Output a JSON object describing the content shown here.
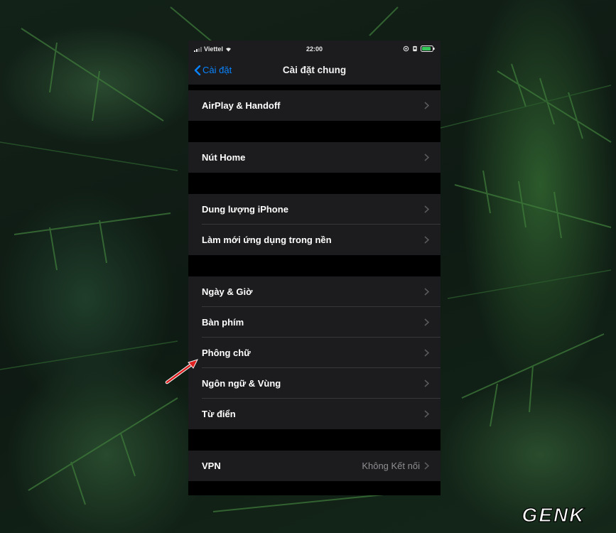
{
  "status_bar": {
    "carrier": "Viettel",
    "time": "22:00"
  },
  "nav": {
    "back_label": "Cài đặt",
    "title": "Cài đặt chung"
  },
  "groups": [
    {
      "items": [
        {
          "label": "AirPlay & Handoff"
        }
      ]
    },
    {
      "items": [
        {
          "label": "Nút Home"
        }
      ]
    },
    {
      "items": [
        {
          "label": "Dung lượng iPhone"
        },
        {
          "label": "Làm mới ứng dụng trong nền"
        }
      ]
    },
    {
      "items": [
        {
          "label": "Ngày & Giờ"
        },
        {
          "label": "Bàn phím"
        },
        {
          "label": "Phông chữ"
        },
        {
          "label": "Ngôn ngữ & Vùng"
        },
        {
          "label": "Từ điển"
        }
      ]
    },
    {
      "items": [
        {
          "label": "VPN",
          "value": "Không Kết nối"
        }
      ]
    }
  ],
  "watermark": "GENK",
  "colors": {
    "accent": "#0a84ff",
    "arrow": "#e02020",
    "row_background": "#1c1c1e",
    "separator_gap": "#000000"
  }
}
